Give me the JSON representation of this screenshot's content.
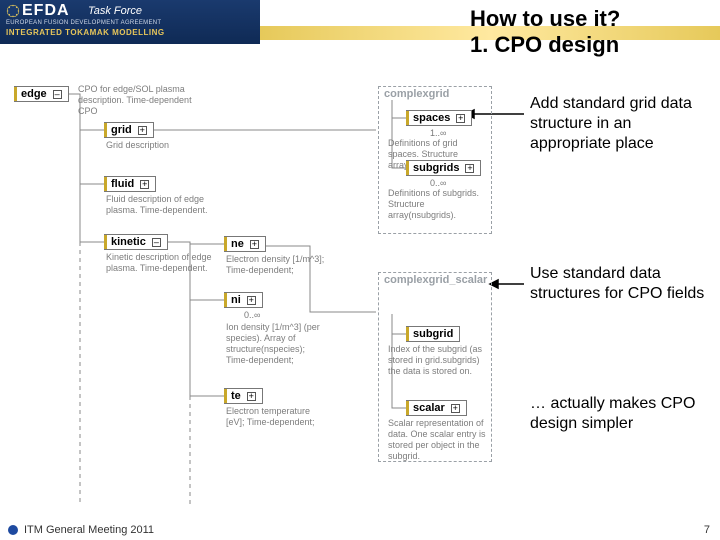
{
  "header": {
    "efda": "EFDA",
    "taskforce": "Task Force",
    "agreement": "EUROPEAN FUSION DEVELOPMENT AGREEMENT",
    "itm": "INTEGRATED TOKAMAK MODELLING"
  },
  "title_line1": "How to use it?",
  "title_line2": "1. CPO design",
  "left_tree": {
    "root": "edge",
    "root_desc": "CPO for edge/SOL plasma description. Time-dependent CPO",
    "grid": {
      "label": "grid",
      "desc": "Grid description"
    },
    "fluid": {
      "label": "fluid",
      "desc": "Fluid description of edge plasma. Time-dependent."
    },
    "kinetic": {
      "label": "kinetic",
      "desc": "Kinetic description of edge plasma. Time-dependent."
    },
    "ne": {
      "label": "ne",
      "desc": "Electron density [1/m^3]; Time-dependent;"
    },
    "ni": {
      "label": "ni",
      "card": "0..∞",
      "desc": "Ion density [1/m^3] (per species). Array of structure(nspecies); Time-dependent;"
    },
    "te": {
      "label": "te",
      "desc": "Electron temperature [eV]; Time-dependent;"
    }
  },
  "group1": {
    "title": "complexgrid",
    "spaces": {
      "label": "spaces",
      "card": "1..∞",
      "desc": "Definitions of grid spaces. Structure array(nspace)."
    },
    "subgrids": {
      "label": "subgrids",
      "card": "0..∞",
      "desc": "Definitions of subgrids. Structure array(nsubgrids)."
    }
  },
  "group2": {
    "title": "complexgrid_scalar",
    "subgrid": {
      "label": "subgrid",
      "desc": "Index of the subgrid (as stored in grid.subgrids) the data is stored on."
    },
    "scalar": {
      "label": "scalar",
      "desc": "Scalar representation of data. One scalar entry is stored per object in the subgrid."
    }
  },
  "annot": {
    "a1": "Add standard grid data structure in an appropriate place",
    "a2": "Use standard data structures for CPO fields",
    "a3": "… actually makes CPO design simpler"
  },
  "footer": "ITM General Meeting 2011",
  "page": "7"
}
